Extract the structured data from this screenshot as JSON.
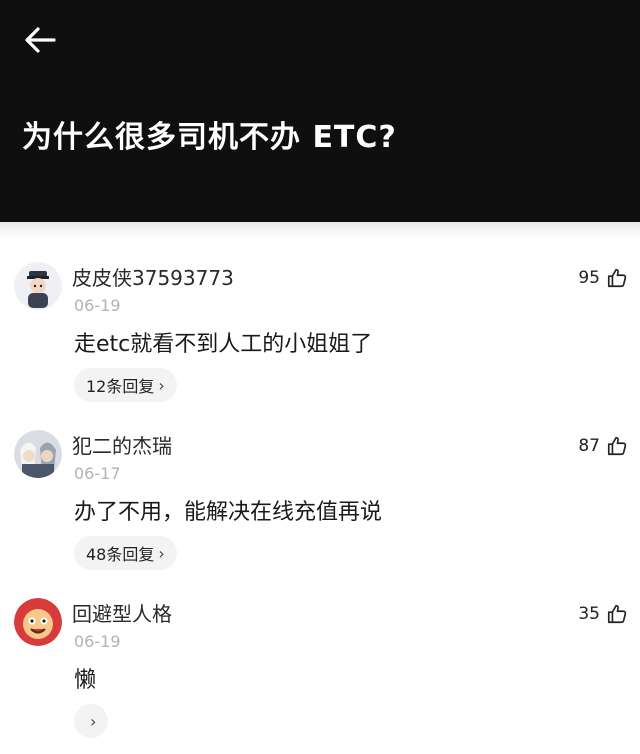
{
  "header": {
    "title": "为什么很多司机不办 ETC?"
  },
  "comments": [
    {
      "username": "皮皮侠37593773",
      "date": "06-19",
      "likes": "95",
      "content": "走etc就看不到人工的小姐姐了",
      "replies_label": "12条回复",
      "avatar_icon": "cartoon-police-avatar"
    },
    {
      "username": "犯二的杰瑞",
      "date": "06-17",
      "likes": "87",
      "content": "办了不用，能解决在线充值再说",
      "replies_label": "48条回复",
      "avatar_icon": "anime-duo-avatar"
    },
    {
      "username": "回避型人格",
      "date": "06-19",
      "likes": "35",
      "content": "懒",
      "replies_label": "",
      "avatar_icon": "cartoon-face-avatar"
    }
  ],
  "colors": {
    "header_bg": "#0f0f0f",
    "reply_pill_bg": "#f3f3f3",
    "date_text": "#b3b3b3"
  }
}
